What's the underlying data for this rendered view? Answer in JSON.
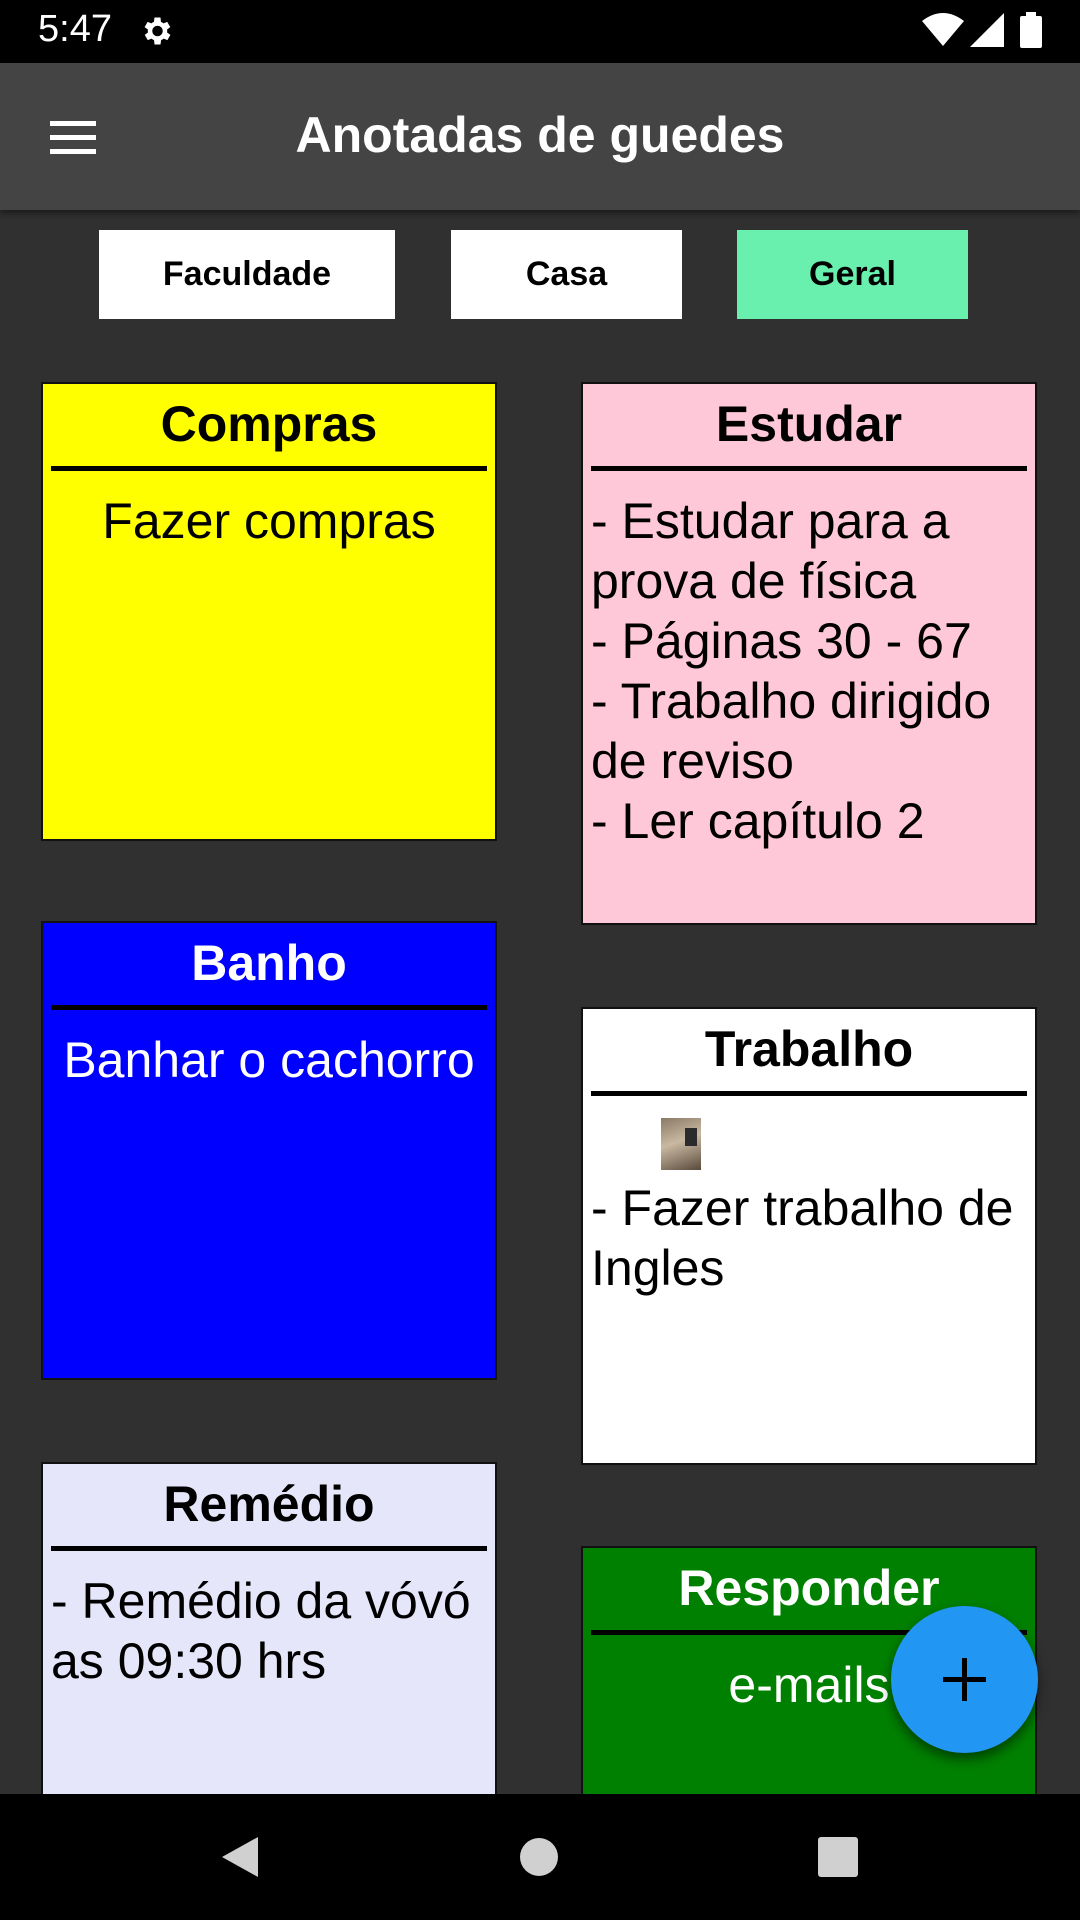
{
  "status_bar": {
    "time": "5:47",
    "icons": [
      "settings-icon",
      "wifi-icon",
      "signal-icon",
      "battery-icon"
    ]
  },
  "app_bar": {
    "title": "Anotadas de guedes",
    "menu_icon": "hamburger-menu-icon"
  },
  "tabs": [
    {
      "label": "Faculdade",
      "selected": false
    },
    {
      "label": "Casa",
      "selected": false
    },
    {
      "label": "Geral",
      "selected": true
    }
  ],
  "notes": [
    {
      "title": "Compras",
      "body": "Fazer compras",
      "color": "#ffff00"
    },
    {
      "title": "Estudar",
      "body": "- Estudar para a\nprova de física\n- Páginas 30 - 67\n- Trabalho dirigido\nde reviso\n- Ler capítulo 2",
      "color": "#ffc8d8"
    },
    {
      "title": "Banho",
      "body": "Banhar o cachorro",
      "color": "#0000ff"
    },
    {
      "title": "Trabalho",
      "body": "- Fazer trabalho de\nIngles",
      "color": "#ffffff",
      "has_image": true
    },
    {
      "title": "Remédio",
      "body": "- Remédio da vóvó\nas 09:30 hrs",
      "color": "#e6e6fa"
    },
    {
      "title": "Responder",
      "body": "e-mails",
      "color": "#008000"
    }
  ],
  "fab": {
    "icon": "plus-icon",
    "color": "#2196f3"
  },
  "nav_bar": {
    "icons": [
      "back-icon",
      "home-icon",
      "recents-icon"
    ]
  },
  "colors": {
    "background": "#303030",
    "app_bar": "#444444",
    "selected_tab": "#69f0ae"
  }
}
